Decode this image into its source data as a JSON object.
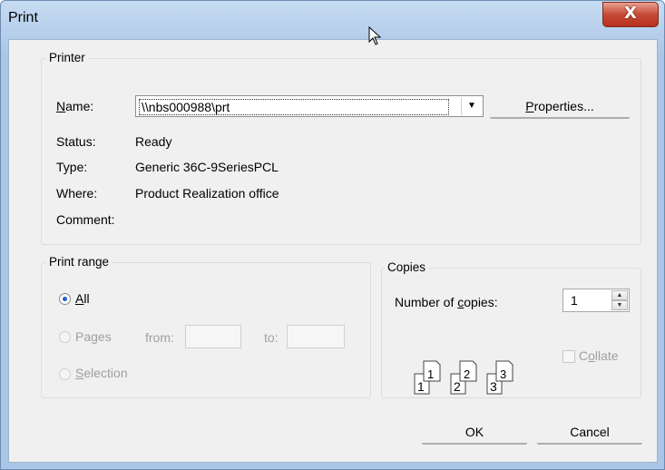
{
  "window": {
    "title": "Print",
    "close_glyph": "X"
  },
  "printer": {
    "legend": "Printer",
    "name_label": "Name:",
    "name_value": "\\\\nbs000988\\prt",
    "properties_button": "Properties...",
    "status_label": "Status:",
    "status_value": "Ready",
    "type_label": "Type:",
    "type_value": "Generic 36C-9SeriesPCL",
    "where_label": "Where:",
    "where_value": "Product Realization office",
    "comment_label": "Comment:",
    "comment_value": ""
  },
  "print_range": {
    "legend": "Print range",
    "options": [
      {
        "label": "All",
        "selected": true,
        "enabled": true
      },
      {
        "label": "Pages",
        "selected": false,
        "enabled": false
      },
      {
        "label": "Selection",
        "selected": false,
        "enabled": false
      }
    ],
    "from_label": "from:",
    "to_label": "to:",
    "from_value": "",
    "to_value": ""
  },
  "copies": {
    "legend": "Copies",
    "number_label": "Number of copies:",
    "number_value": "1",
    "collate_label": "Collate",
    "collate_checked": false,
    "collate_enabled": false,
    "collate_pages": [
      {
        "big": "1",
        "small": "1"
      },
      {
        "big": "2",
        "small": "2"
      },
      {
        "big": "3",
        "small": "3"
      }
    ]
  },
  "buttons": {
    "ok": "OK",
    "cancel": "Cancel"
  },
  "colors": {
    "titlebar": "#b9d1ec",
    "close": "#c64a36",
    "radio_dot": "#1f63c4",
    "face": "#f0f0f0"
  },
  "icons": {
    "close": "close-icon",
    "cursor": "mouse-pointer-icon",
    "dropdown": "chevron-down-icon"
  }
}
